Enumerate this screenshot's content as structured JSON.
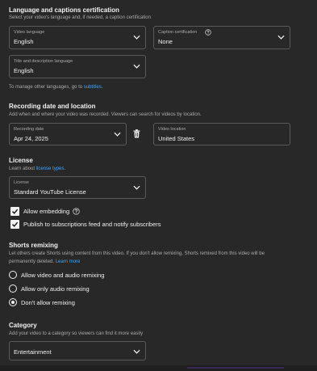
{
  "lang_section": {
    "title": "Language and captions certification",
    "subtitle": "Select your video's language and, if needed, a caption certification",
    "video_language": {
      "label": "Video language",
      "value": "English"
    },
    "caption_cert": {
      "label": "Caption certification",
      "value": "None",
      "icon": "help-icon"
    },
    "title_desc_language": {
      "label": "Title and description language",
      "value": "English"
    },
    "manage_prefix": "To manage other languages, go to ",
    "manage_link": "subtitles",
    "manage_suffix": "."
  },
  "recording_section": {
    "title": "Recording date and location",
    "subtitle": "Add when and where your video was recorded. Viewers can search for videos by location.",
    "date": {
      "label": "Recording date",
      "value": "Apr 24, 2025"
    },
    "delete_icon": "trash-icon",
    "location": {
      "label": "Video location",
      "value": "United States"
    }
  },
  "license_section": {
    "title": "License",
    "learn_prefix": "Learn about ",
    "learn_link": "license types",
    "learn_suffix": ".",
    "license": {
      "label": "License",
      "value": "Standard YouTube License"
    },
    "allow_embedding": {
      "label": "Allow embedding",
      "checked": true,
      "icon": "help-icon"
    },
    "publish_feed": {
      "label": "Publish to subscriptions feed and notify subscribers",
      "checked": true
    }
  },
  "shorts_section": {
    "title": "Shorts remixing",
    "desc_line1": "Let others create Shorts using content from this video. If you don't allow remixing, Shorts remixed from this video will be",
    "desc_line2_prefix": "permanently deleted. ",
    "learn_more": "Learn more",
    "options": [
      {
        "label": "Allow video and audio remixing",
        "selected": false
      },
      {
        "label": "Allow only audio remixing",
        "selected": false
      },
      {
        "label": "Don't allow remixing",
        "selected": true
      }
    ]
  },
  "category_section": {
    "title": "Category",
    "subtitle": "Add your video to a category so viewers can find it more easily",
    "category": {
      "value": "Entertainment"
    }
  },
  "colors": {
    "background": "#282828",
    "link": "#3ea6ff",
    "border": "#5a5a5a"
  }
}
